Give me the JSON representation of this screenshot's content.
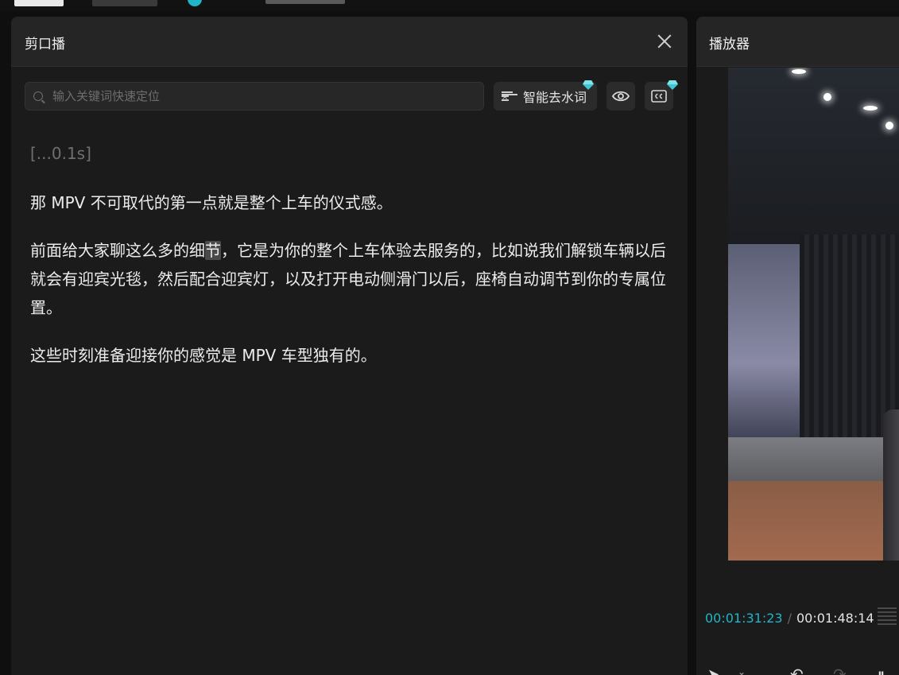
{
  "panel": {
    "title": "剪口播",
    "search_placeholder": "输入关键词快速定位",
    "remove_filler_label": "智能去水词"
  },
  "transcript": {
    "gap": "[...0.1s]",
    "p1": "那 MPV 不可取代的第一点就是整个上车的仪式感。",
    "p2_before": "前面给大家聊这么多的细",
    "p2_highlight": "节",
    "p2_after": "，它是为你的整个上车体验去服务的，比如说我们解锁车辆以后就会有迎宾光毯，然后配合迎宾灯，以及打开电动侧滑门以后，座椅自动调节到你的专属位置。",
    "p3": "这些时刻准备迎接你的感觉是 MPV 车型独有的。"
  },
  "player": {
    "title": "播放器",
    "current_time": "00:01:31:23",
    "separator": "/",
    "total_time": "00:01:48:14"
  },
  "colors": {
    "accent": "#1fb6c8",
    "panel_bg": "#1b1b1b",
    "header_bg": "#252525"
  }
}
